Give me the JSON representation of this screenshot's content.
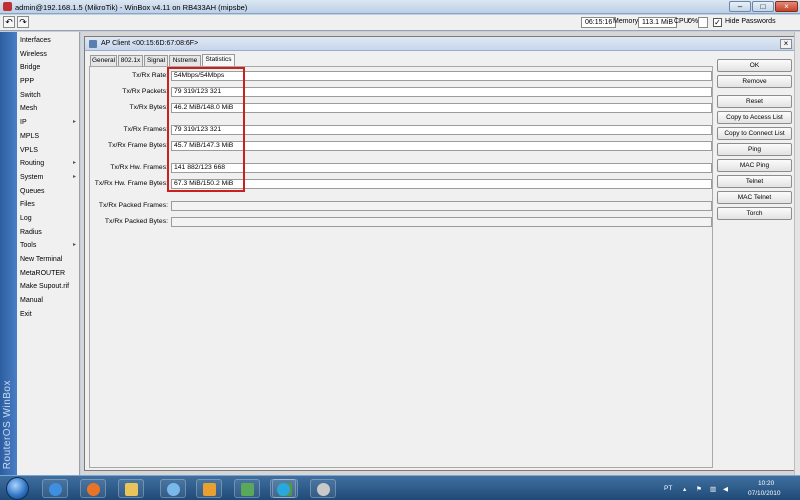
{
  "window": {
    "title": "admin@192.168.1.5 (MikroTik) - WinBox v4.11 on RB433AH (mipsbe)"
  },
  "toolbar": {
    "undo_icon": "undo-icon",
    "redo_icon": "redo-icon",
    "time": "06:15:16",
    "memory_label": "Memory:",
    "memory_value": "113.1 MiB",
    "cpu_label": "CPU:",
    "cpu_value": "0%",
    "hide_passwords_label": "Hide Passwords",
    "hide_passwords_checked": "✓"
  },
  "sidebar": {
    "brand": "RouterOS WinBox",
    "items": [
      {
        "label": "Interfaces",
        "arrow": ""
      },
      {
        "label": "Wireless",
        "arrow": ""
      },
      {
        "label": "Bridge",
        "arrow": ""
      },
      {
        "label": "PPP",
        "arrow": ""
      },
      {
        "label": "Switch",
        "arrow": ""
      },
      {
        "label": "Mesh",
        "arrow": ""
      },
      {
        "label": "IP",
        "arrow": "▸"
      },
      {
        "label": "MPLS",
        "arrow": ""
      },
      {
        "label": "VPLS",
        "arrow": ""
      },
      {
        "label": "Routing",
        "arrow": "▸"
      },
      {
        "label": "System",
        "arrow": "▸"
      },
      {
        "label": "Queues",
        "arrow": ""
      },
      {
        "label": "Files",
        "arrow": ""
      },
      {
        "label": "Log",
        "arrow": ""
      },
      {
        "label": "Radius",
        "arrow": ""
      },
      {
        "label": "Tools",
        "arrow": "▸"
      },
      {
        "label": "New Terminal",
        "arrow": ""
      },
      {
        "label": "MetaROUTER",
        "arrow": ""
      },
      {
        "label": "Make Supout.rif",
        "arrow": ""
      },
      {
        "label": "Manual",
        "arrow": ""
      },
      {
        "label": "Exit",
        "arrow": ""
      }
    ]
  },
  "dialog": {
    "title": "AP Client <00:15:6D:67:08:6F>",
    "close_label": "×",
    "tabs": [
      "General",
      "802.1x",
      "Signal",
      "Nstreme",
      "Statistics"
    ],
    "active_tab": "Statistics",
    "fields": [
      {
        "label": "Tx/Rx Rate:",
        "value": "54Mbps/54Mbps"
      },
      {
        "label": "Tx/Rx Packets:",
        "value": "79 319/123 321"
      },
      {
        "label": "Tx/Rx Bytes:",
        "value": "46.2 MiB/148.0 MiB"
      },
      {
        "label": "Tx/Rx Frames:",
        "value": "79 319/123 321"
      },
      {
        "label": "Tx/Rx Frame Bytes:",
        "value": "45.7 MiB/147.3 MiB"
      },
      {
        "label": "Tx/Rx Hw. Frames:",
        "value": "141 882/123 668"
      },
      {
        "label": "Tx/Rx Hw. Frame Bytes:",
        "value": "67.3 MiB/150.2 MiB"
      },
      {
        "label": "Tx/Rx Packed Frames:",
        "value": ""
      },
      {
        "label": "Tx/Rx Packed Bytes:",
        "value": ""
      }
    ],
    "buttons": [
      "OK",
      "Remove",
      "Reset",
      "Copy to Access List",
      "Copy to Connect List",
      "Ping",
      "MAC Ping",
      "Telnet",
      "MAC Telnet",
      "Torch"
    ]
  },
  "taskbar": {
    "language": "PT",
    "clock_time": "10:20",
    "clock_date": "07/10/2010",
    "apps": [
      "internet-explorer-icon",
      "firefox-icon",
      "explorer-folder-icon",
      "network-icon",
      "media-player-icon",
      "winbox-icon",
      "solitaire-icon",
      "skype-icon",
      "paint-icon"
    ],
    "colors": {
      "highlight_box": "#cc2020"
    }
  }
}
